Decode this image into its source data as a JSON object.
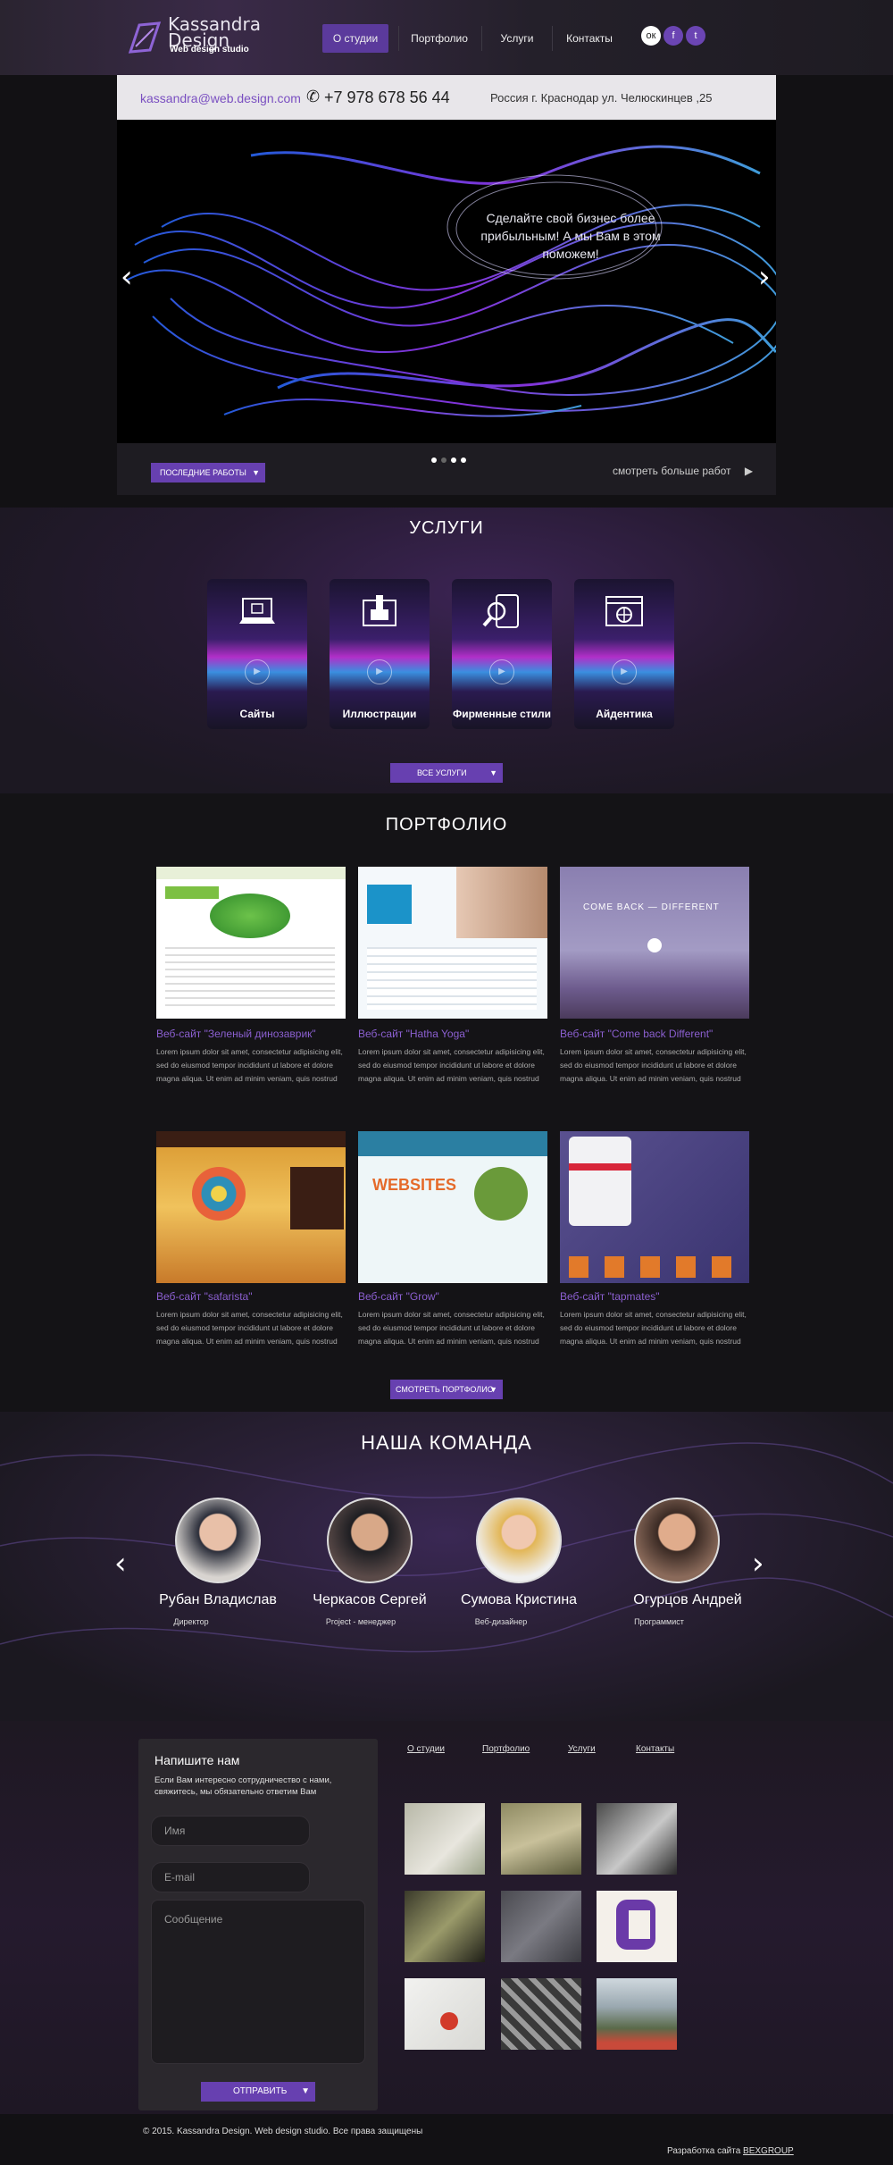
{
  "header": {
    "logo_title_1": "Kassandra",
    "logo_title_2": "Design",
    "logo_subtitle": "Web design studio",
    "nav": [
      "О студии",
      "Портфолио",
      "Услуги",
      "Контакты"
    ],
    "active_nav": "О студии",
    "social_icons": [
      "odnoklassniki-icon",
      "facebook-icon",
      "twitter-icon"
    ],
    "accent": "#6740b0"
  },
  "contact_bar": {
    "email": "kassandra@web.design.com",
    "phone": "+7 978 678 56 44",
    "address": "Россия г. Краснодар ул. Челюскинцев ,25"
  },
  "slider": {
    "text": "Сделайте свой бизнес более прибыльным! А мы Вам в этом поможем!",
    "prev": "‹",
    "next": "›",
    "latest_button": "ПОСЛЕДНИЕ РАБОТЫ",
    "more_link": "смотреть больше работ"
  },
  "services": {
    "title": "УСЛУГИ",
    "items": [
      "Сайты",
      "Иллюстрации",
      "Фирменные стили",
      "Айдентика"
    ],
    "all_button": "ВСЕ УСЛУГИ"
  },
  "portfolio": {
    "title": "ПОРТФОЛИО",
    "items": [
      {
        "title": "Веб-сайт \"Зеленый динозаврик\"",
        "text": "Lorem ipsum dolor sit amet, consectetur adipisicing elit, sed do eiusmod tempor incididunt ut labore et dolore magna aliqua. Ut enim ad minim veniam, quis nostrud"
      },
      {
        "title": "Веб-сайт \"Hatha Yoga\"",
        "text": "Lorem ipsum dolor sit amet, consectetur adipisicing elit, sed do eiusmod tempor incididunt ut labore et dolore magna aliqua. Ut enim ad minim veniam, quis nostrud"
      },
      {
        "title": "Веб-сайт \"Come back Different\"",
        "text": "Lorem ipsum dolor sit amet, consectetur adipisicing elit, sed do eiusmod tempor incididunt ut labore et dolore magna aliqua. Ut enim ad minim veniam, quis nostrud"
      },
      {
        "title": "Веб-сайт \"safarista\"",
        "text": "Lorem ipsum dolor sit amet, consectetur adipisicing elit, sed do eiusmod tempor incididunt ut labore et dolore magna aliqua. Ut enim ad minim veniam, quis nostrud"
      },
      {
        "title": "Веб-сайт \"Grow\"",
        "text": "Lorem ipsum dolor sit amet, consectetur adipisicing elit, sed do eiusmod tempor incididunt ut labore et dolore magna aliqua. Ut enim ad minim veniam, quis nostrud"
      },
      {
        "title": "Веб-сайт \"tapmates\"",
        "text": "Lorem ipsum dolor sit amet, consectetur adipisicing elit, sed do eiusmod tempor incididunt ut labore et dolore magna aliqua. Ut enim ad minim veniam, quis nostrud"
      }
    ],
    "more_button": "СМОТРЕТЬ ПОРТФОЛИО"
  },
  "team": {
    "title": "НАША КОМАНДА",
    "members": [
      {
        "name": "Рубан Владислав",
        "role": "Директор"
      },
      {
        "name": "Черкасов Сергей",
        "role": "Project - менеджер"
      },
      {
        "name": "Сумова Кристина",
        "role": "Веб-дизайнер"
      },
      {
        "name": "Огурцов Андрей",
        "role": "Программист"
      }
    ]
  },
  "footer": {
    "form_title": "Напишите нам",
    "form_desc": "Если Вам интересно сотрудничество с нами, свяжитесь, мы обязательно ответим Вам",
    "name_placeholder": "Имя",
    "email_placeholder": "E-mail",
    "message_placeholder": "Сообщение",
    "send_button": "ОТПРАВИТЬ",
    "links": [
      "О студии",
      "Портфолио",
      "Услуги",
      "Контакты"
    ],
    "copyright": "© 2015. Kassandra Design. Web design studio.  Все права защищены",
    "dev_label": "Разработка сайта",
    "dev_link": "BEXGROUP"
  }
}
